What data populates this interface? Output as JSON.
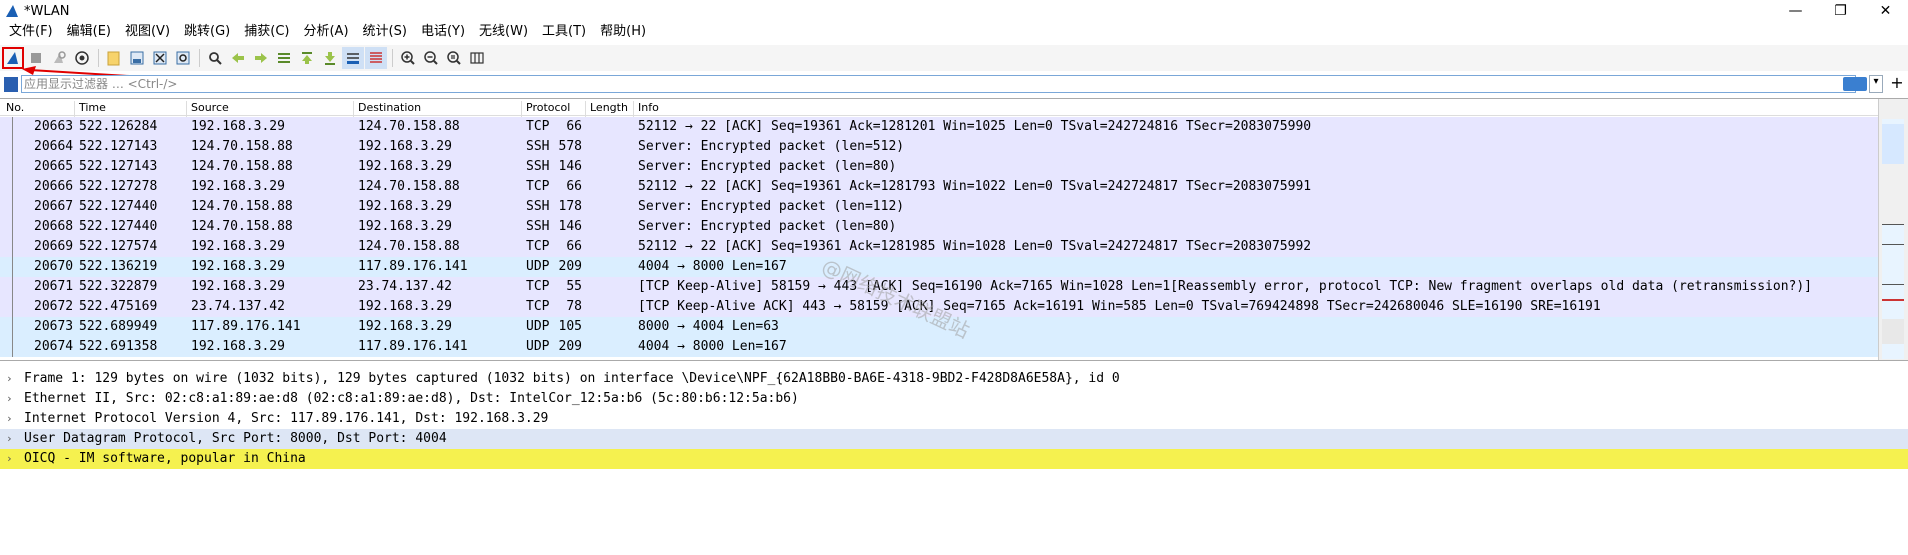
{
  "window": {
    "title": "*WLAN",
    "minimize_glyph": "—",
    "restore_glyph": "❐",
    "close_glyph": "✕"
  },
  "menu": [
    "文件(F)",
    "编辑(E)",
    "视图(V)",
    "跳转(G)",
    "捕获(C)",
    "分析(A)",
    "统计(S)",
    "电话(Y)",
    "无线(W)",
    "工具(T)",
    "帮助(H)"
  ],
  "toolbar": {
    "icons": [
      "shark-fin-start-icon",
      "stop-icon",
      "restart-icon",
      "options-icon",
      "open-file-icon",
      "save-file-icon",
      "close-file-icon",
      "reload-icon",
      "find-icon",
      "back-icon",
      "forward-icon",
      "go-to-packet-icon",
      "first-packet-icon",
      "last-packet-icon",
      "autoscroll-icon",
      "colorize-icon",
      "zoom-in-icon",
      "zoom-out-icon",
      "zoom-normal-icon",
      "resize-columns-icon"
    ]
  },
  "filter": {
    "placeholder": "应用显示过滤器 … <Ctrl-/>",
    "plus": "+",
    "dropdown": "▾"
  },
  "packet_list": {
    "columns": [
      "No.",
      "Time",
      "Source",
      "Destination",
      "Protocol",
      "Length",
      "Info"
    ],
    "rows": [
      {
        "no": "20663",
        "time": "522.126284",
        "src": "192.168.3.29",
        "dst": "124.70.158.88",
        "proto": "TCP",
        "len": "66",
        "info": "52112 → 22 [ACK] Seq=19361 Ack=1281201 Win=1025 Len=0 TSval=242724816 TSecr=2083075990"
      },
      {
        "no": "20664",
        "time": "522.127143",
        "src": "124.70.158.88",
        "dst": "192.168.3.29",
        "proto": "SSH",
        "len": "578",
        "info": "Server: Encrypted packet (len=512)"
      },
      {
        "no": "20665",
        "time": "522.127143",
        "src": "124.70.158.88",
        "dst": "192.168.3.29",
        "proto": "SSH",
        "len": "146",
        "info": "Server: Encrypted packet (len=80)"
      },
      {
        "no": "20666",
        "time": "522.127278",
        "src": "192.168.3.29",
        "dst": "124.70.158.88",
        "proto": "TCP",
        "len": "66",
        "info": "52112 → 22 [ACK] Seq=19361 Ack=1281793 Win=1022 Len=0 TSval=242724817 TSecr=2083075991"
      },
      {
        "no": "20667",
        "time": "522.127440",
        "src": "124.70.158.88",
        "dst": "192.168.3.29",
        "proto": "SSH",
        "len": "178",
        "info": "Server: Encrypted packet (len=112)"
      },
      {
        "no": "20668",
        "time": "522.127440",
        "src": "124.70.158.88",
        "dst": "192.168.3.29",
        "proto": "SSH",
        "len": "146",
        "info": "Server: Encrypted packet (len=80)"
      },
      {
        "no": "20669",
        "time": "522.127574",
        "src": "192.168.3.29",
        "dst": "124.70.158.88",
        "proto": "TCP",
        "len": "66",
        "info": "52112 → 22 [ACK] Seq=19361 Ack=1281985 Win=1028 Len=0 TSval=242724817 TSecr=2083075992"
      },
      {
        "no": "20670",
        "time": "522.136219",
        "src": "192.168.3.29",
        "dst": "117.89.176.141",
        "proto": "UDP",
        "len": "209",
        "info": "4004 → 8000 Len=167"
      },
      {
        "no": "20671",
        "time": "522.322879",
        "src": "192.168.3.29",
        "dst": "23.74.137.42",
        "proto": "TCP",
        "len": "55",
        "info": "[TCP Keep-Alive] 58159 → 443 [ACK] Seq=16190 Ack=7165 Win=1028 Len=1[Reassembly error, protocol TCP: New fragment overlaps old data (retransmission?)]"
      },
      {
        "no": "20672",
        "time": "522.475169",
        "src": "23.74.137.42",
        "dst": "192.168.3.29",
        "proto": "TCP",
        "len": "78",
        "info": "[TCP Keep-Alive ACK] 443 → 58159 [ACK] Seq=7165 Ack=16191 Win=585 Len=0 TSval=769424898 TSecr=242680046 SLE=16190 SRE=16191"
      },
      {
        "no": "20673",
        "time": "522.689949",
        "src": "117.89.176.141",
        "dst": "192.168.3.29",
        "proto": "UDP",
        "len": "105",
        "info": "8000 → 4004 Len=63"
      },
      {
        "no": "20674",
        "time": "522.691358",
        "src": "192.168.3.29",
        "dst": "117.89.176.141",
        "proto": "UDP",
        "len": "209",
        "info": "4004 → 8000 Len=167"
      }
    ]
  },
  "details": [
    {
      "text": "Frame 1: 129 bytes on wire (1032 bits), 129 bytes captured (1032 bits) on interface \\Device\\NPF_{62A18BB0-BA6E-4318-9BD2-F428D8A6E58A}, id 0",
      "style": "normal"
    },
    {
      "text": "Ethernet II, Src: 02:c8:a1:89:ae:d8 (02:c8:a1:89:ae:d8), Dst: IntelCor_12:5a:b6 (5c:80:b6:12:5a:b6)",
      "style": "normal"
    },
    {
      "text": "Internet Protocol Version 4, Src: 117.89.176.141, Dst: 192.168.3.29",
      "style": "normal"
    },
    {
      "text": "User Datagram Protocol, Src Port: 8000, Dst Port: 4004",
      "style": "light"
    },
    {
      "text": "OICQ - IM software, popular in China",
      "style": "yellow"
    }
  ],
  "watermark": "@网络技术联盟站",
  "colors": {
    "tcp_row": "#e7e6ff",
    "udp_row": "#daeeff",
    "highlight_yellow": "#f5f14f",
    "annotation_red": "#e00000"
  }
}
